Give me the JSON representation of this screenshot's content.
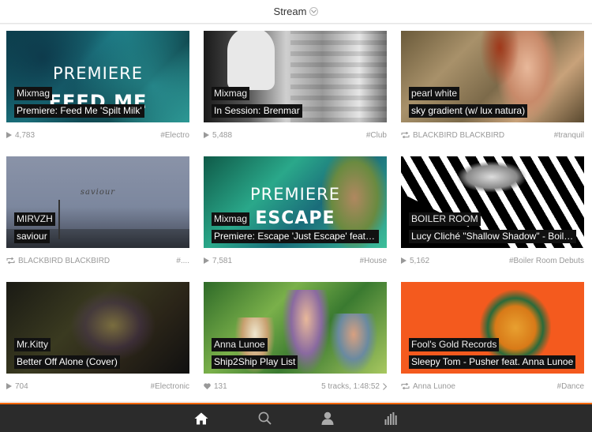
{
  "header": {
    "title": "Stream"
  },
  "tracks": [
    {
      "user": "Mixmag",
      "title": "Premiere: Feed Me 'Spilt Milk'",
      "big1": "PREMIERE",
      "big2": "FEED ME",
      "stat_icon": "play-icon",
      "stat": "4,783",
      "tag": "#Electro"
    },
    {
      "user": "Mixmag",
      "title": "In Session:  Brenmar",
      "stat_icon": "play-icon",
      "stat": "5,488",
      "tag": "#Club"
    },
    {
      "user": "pearl white",
      "title": "sky gradient  (w/ lux natura)",
      "stat_icon": "repost-icon",
      "stat": "BLACKBIRD BLACKBIRD",
      "tag": "#tranquil"
    },
    {
      "user": "MIRVZH",
      "title": "saviour",
      "art_text": "saviour",
      "stat_icon": "repost-icon",
      "stat": "BLACKBIRD BLACKBIRD",
      "tag": "#...."
    },
    {
      "user": "Mixmag",
      "title": "Premiere: Escape 'Just Escape' feat D...",
      "big1": "PREMIERE",
      "big2": "ESCAPE",
      "stat_icon": "play-icon",
      "stat": "7,581",
      "tag": "#House"
    },
    {
      "user": "BOILER ROOM",
      "title": "Lucy Cliché \"Shallow Shadow\" - Boile...",
      "stat_icon": "play-icon",
      "stat": "5,162",
      "tag": "#Boiler Room Debuts"
    },
    {
      "user": "Mr.Kitty",
      "title": "Better Off Alone (Cover)",
      "stat_icon": "play-icon",
      "stat": "704",
      "tag": "#Electronic"
    },
    {
      "user": "Anna Lunoe",
      "title": "Ship2Ship Play List",
      "stat_icon": "heart-icon",
      "stat": "131",
      "tag": "5 tracks, 1:48:52"
    },
    {
      "user": "Fool's Gold Records",
      "title": "Sleepy Tom - Pusher feat. Anna Lunoe",
      "stat_icon": "repost-icon",
      "stat": "Anna Lunoe",
      "tag": "#Dance"
    }
  ],
  "tabs": [
    "home-icon",
    "search-icon",
    "user-icon",
    "activity-icon"
  ],
  "colors": {
    "accent": "#ff6600",
    "tabbar": "#2b2b2b"
  }
}
